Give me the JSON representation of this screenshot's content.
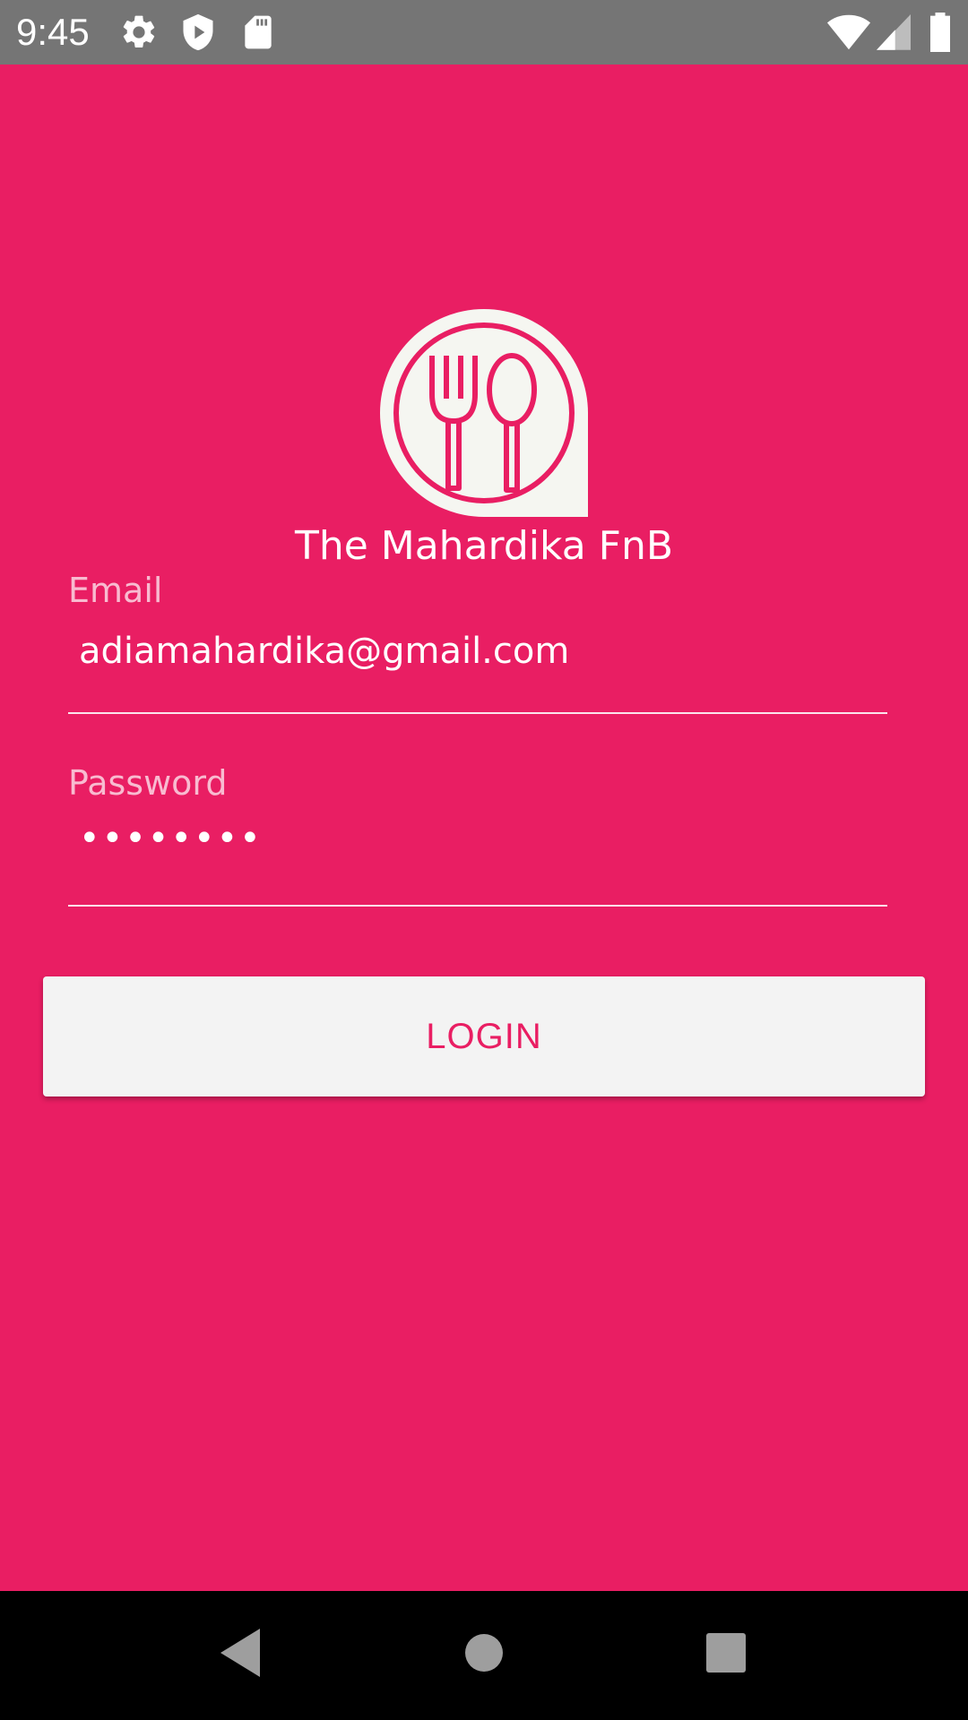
{
  "status_bar": {
    "time": "9:45",
    "left_icons": [
      "settings-icon",
      "shield-play-icon",
      "sd-card-icon"
    ],
    "right_icons": [
      "wifi-icon",
      "cellular-signal-icon",
      "battery-icon"
    ]
  },
  "app": {
    "title": "The Mahardika FnB",
    "logo_icon": "fork-spoon-icon",
    "colors": {
      "primary": "#e91e63",
      "button_bg": "#f3f3f3",
      "text": "#ffffff"
    }
  },
  "form": {
    "email_label": "Email",
    "email_value": "adiamahardika@gmail.com",
    "password_label": "Password",
    "password_value": "••••••••",
    "login_label": "LOGIN"
  },
  "nav_bar": {
    "buttons": [
      "back-icon",
      "home-icon",
      "recents-icon"
    ]
  }
}
